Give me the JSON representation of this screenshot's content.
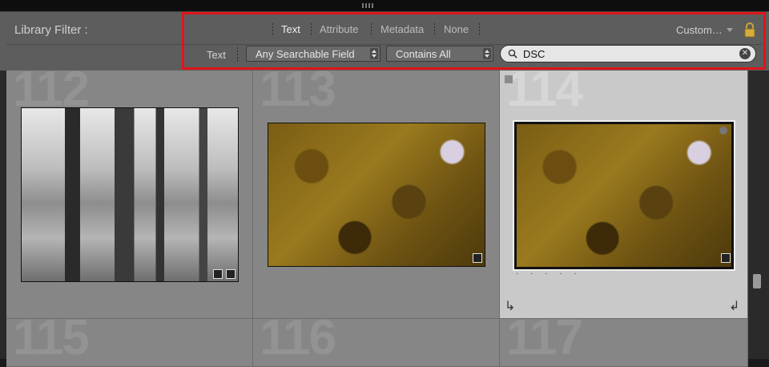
{
  "filter_bar": {
    "title": "Library Filter :",
    "tabs": [
      {
        "label": "Text",
        "active": true
      },
      {
        "label": "Attribute",
        "active": false
      },
      {
        "label": "Metadata",
        "active": false
      },
      {
        "label": "None",
        "active": false
      }
    ],
    "preset": "Custom…",
    "text_rule": {
      "label": "Text",
      "field_select": "Any Searchable Field",
      "match_select": "Contains All",
      "search_value": "DSC"
    }
  },
  "grid": {
    "cells": [
      {
        "index": "112",
        "image": "black-and-white forest",
        "selected": false
      },
      {
        "index": "113",
        "image": "autumn leaves canopy",
        "selected": false
      },
      {
        "index": "114",
        "image": "autumn leaves canopy",
        "selected": true,
        "rating_dots": "· · · · ·"
      },
      {
        "index": "115",
        "selected": false
      },
      {
        "index": "116",
        "selected": false
      },
      {
        "index": "117",
        "selected": false
      }
    ]
  },
  "colors": {
    "highlight": "#e0151b",
    "bar_bg": "#5d5d5d",
    "cell_bg": "#868686",
    "cell_selected_bg": "#c9c9c9"
  }
}
